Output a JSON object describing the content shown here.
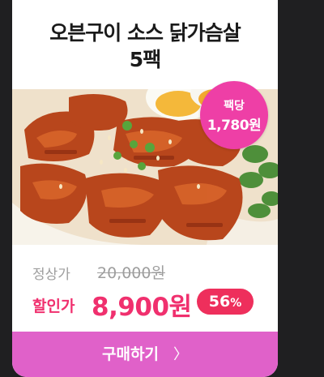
{
  "product": {
    "title_line1": "오븐구이 소스 닭가슴살",
    "title_line2": "5팩",
    "image_alt": "Sauced oven-roasted chicken breast pieces with sesame, green onion, egg and greens",
    "pack_badge": {
      "line1": "팩당",
      "line2": "1,780원"
    },
    "regular_label": "정상가",
    "regular_price": "20,000원",
    "sale_label": "할인가",
    "sale_price": "8,900원",
    "discount_value": "56",
    "discount_unit": "%",
    "buy_label": "구매하기",
    "buy_chevron": "〉"
  },
  "colors": {
    "background": "#1f1f21",
    "accent_pink": "#f0306e",
    "badge_pink": "#ee3fa6",
    "button_pink": "#e061c9"
  },
  "icons": {
    "buy_chevron": "chevron-right-icon"
  }
}
